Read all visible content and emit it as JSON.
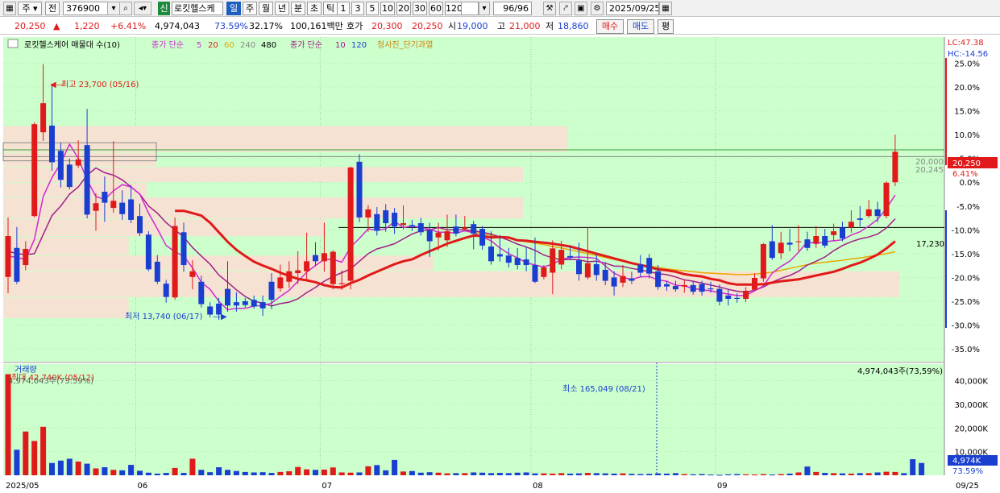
{
  "toolbar": {
    "period": "주",
    "prev_label": "전",
    "code": "376900",
    "market_badge": "신",
    "name": "로킷헬스케",
    "tabs": [
      "일",
      "주",
      "월",
      "년",
      "분",
      "초",
      "틱"
    ],
    "active_tab": "일",
    "intervals": [
      "1",
      "3",
      "5",
      "10",
      "20",
      "30",
      "60",
      "120"
    ],
    "count": "96/96",
    "date": "2025/09/25"
  },
  "quote": {
    "price": "20,250",
    "change": "1,220",
    "change_pct": "+6.41%",
    "volume": "4,974,043",
    "vol_ratio": "73.59%",
    "turnover": "32.17%",
    "amount": "100,161백만",
    "ask_label": "호가",
    "ask": "20,300",
    "bid": "20,250",
    "open_label": "시",
    "open": "19,000",
    "high_label": "고",
    "high": "21,000",
    "low_label": "저",
    "low": "18,860",
    "buy_label": "매수",
    "sell_label": "매도",
    "avg_label": "평"
  },
  "legend": {
    "item1": "로킷헬스케어 매물대 수(10)",
    "item2": "종가 단순",
    "ma_a": [
      "5",
      "20",
      "60",
      "240",
      "480"
    ],
    "item3": "종가 단순",
    "ma_b": [
      "10",
      "120"
    ],
    "item4": "청사진_단기과열"
  },
  "annotations": {
    "high": "최고 23,700 (05/16)",
    "low": "최저 13,740 (06/17)",
    "vol_title": "거래량",
    "vol_max": "최대 42,740K (05/12)",
    "vol_ref": "4,974,043주(73.59%)",
    "vol_min": "최소 165,049 (08/21)",
    "vol_top_right": "4,974,043주(73,59%)",
    "lc": "LC:47.38",
    "hc": "HC:-14.56",
    "price_tag": "20,250",
    "pct_tag": "6.41%",
    "line_20000": "20,000",
    "line_20245": "20,245",
    "hline_label": "17,230",
    "vol_tag": "4,974K",
    "vol_tag_pct": "73.59%"
  },
  "colors": {
    "up": "#e01a1a",
    "down": "#1a3fd0",
    "ma5": "#d02ad0",
    "ma20": "#e01a1a",
    "ma60": "#e8a800",
    "ma10": "#a0208a",
    "plot_bg": "#ccffcc",
    "supply": "#f6e2d2"
  },
  "chart_data": {
    "type": "candlestick",
    "y_ticks": [
      "25.0%",
      "20.0%",
      "15.0%",
      "10.0%",
      "5.0%",
      "0.0%",
      "-5.0%",
      "-10.0%",
      "-15.0%",
      "-20.0%",
      "-25.0%",
      "-30.0%",
      "-35.0%"
    ],
    "y_range_pct": [
      -37.7,
      30.5
    ],
    "vol_ticks": [
      "40,000K",
      "30,000K",
      "20,000K",
      "10,000K"
    ],
    "vol_range": [
      0,
      47000
    ],
    "x_labels": [
      "2025/05",
      "06",
      "07",
      "08",
      "09",
      "09/25"
    ],
    "hline_pct": -9.5,
    "candles": [
      {
        "o": -19.9,
        "c": -11.3,
        "h": -7.4,
        "l": -23.3
      },
      {
        "o": -13.8,
        "c": -20.9,
        "h": -9.4,
        "l": -21.4
      },
      {
        "o": -17.4,
        "c": -14.0,
        "h": -12.4,
        "l": -18.5
      },
      {
        "o": -7.1,
        "c": 12.2,
        "h": 12.6,
        "l": -7.4
      },
      {
        "o": 10.5,
        "c": 16.6,
        "h": 24.8,
        "l": 8.7
      },
      {
        "o": 11.9,
        "c": 4.2,
        "h": 20.4,
        "l": 2.4
      },
      {
        "o": 6.6,
        "c": 0.5,
        "h": 8.3,
        "l": -1.1
      },
      {
        "o": 3.7,
        "c": -1.0,
        "h": 5.0,
        "l": -1.5
      },
      {
        "o": 3.5,
        "c": 4.8,
        "h": 8.8,
        "l": 3.0
      },
      {
        "o": 7.8,
        "c": -6.8,
        "h": 15.4,
        "l": -7.6
      },
      {
        "o": -6.0,
        "c": -4.4,
        "h": -2.3,
        "l": -10.2
      },
      {
        "o": -2.0,
        "c": -4.3,
        "h": 1.2,
        "l": -8.3
      },
      {
        "o": -5.4,
        "c": -3.9,
        "h": 8.6,
        "l": -6.4
      },
      {
        "o": -4.3,
        "c": -6.7,
        "h": -1.7,
        "l": -7.9
      },
      {
        "o": -3.6,
        "c": -7.9,
        "h": -0.6,
        "l": -8.6
      },
      {
        "o": -7.1,
        "c": -10.7,
        "h": -4.5,
        "l": -11.3
      },
      {
        "o": -11.0,
        "c": -18.3,
        "h": -10.3,
        "l": -18.7
      },
      {
        "o": -16.7,
        "c": -20.9,
        "h": -15.3,
        "l": -21.4
      },
      {
        "o": -21.3,
        "c": -24.1,
        "h": -20.5,
        "l": -25.3
      },
      {
        "o": -24.2,
        "c": -9.2,
        "h": -7.4,
        "l": -24.7
      },
      {
        "o": -10.5,
        "c": -17.4,
        "h": -8.5,
        "l": -18.8
      },
      {
        "o": -19.9,
        "c": -18.7,
        "h": -16.4,
        "l": -22.5
      },
      {
        "o": -20.9,
        "c": -25.6,
        "h": -19.6,
        "l": -26.3
      },
      {
        "o": -26.1,
        "c": -27.8,
        "h": -25.2,
        "l": -28.4
      },
      {
        "o": -25.5,
        "c": -27.8,
        "h": -24.3,
        "l": -28.9
      },
      {
        "o": -22.4,
        "c": -25.9,
        "h": -16.6,
        "l": -27.2
      },
      {
        "o": -25.2,
        "c": -25.9,
        "h": -23.1,
        "l": -27.2
      },
      {
        "o": -25.0,
        "c": -25.8,
        "h": -24.3,
        "l": -26.3
      },
      {
        "o": -24.7,
        "c": -26.1,
        "h": -23.8,
        "l": -26.6
      },
      {
        "o": -25.2,
        "c": -26.5,
        "h": -23.8,
        "l": -28.1
      },
      {
        "o": -20.9,
        "c": -24.7,
        "h": -19.1,
        "l": -26.7
      },
      {
        "o": -22.3,
        "c": -20.0,
        "h": -17.3,
        "l": -23.0
      },
      {
        "o": -20.9,
        "c": -18.7,
        "h": -16.6,
        "l": -22.2
      },
      {
        "o": -19.1,
        "c": -18.5,
        "h": -14.5,
        "l": -21.4
      },
      {
        "o": -18.7,
        "c": -16.6,
        "h": -10.6,
        "l": -20.7
      },
      {
        "o": -15.3,
        "c": -16.6,
        "h": -12.6,
        "l": -17.6
      },
      {
        "o": -16.6,
        "c": -14.9,
        "h": -8.5,
        "l": -18.8
      },
      {
        "o": -21.4,
        "c": -14.6,
        "h": -14.3,
        "l": -22.5
      },
      {
        "o": -21.4,
        "c": -21.2,
        "h": -18.5,
        "l": -22.6
      },
      {
        "o": -20.7,
        "c": 3.1,
        "h": 3.3,
        "l": -22.5
      },
      {
        "o": 4.3,
        "c": -7.4,
        "h": 5.9,
        "l": -8.4
      },
      {
        "o": -7.4,
        "c": -5.7,
        "h": -4.8,
        "l": -10.4
      },
      {
        "o": -6.7,
        "c": -10.2,
        "h": -5.2,
        "l": -11.2
      },
      {
        "o": -5.9,
        "c": -8.6,
        "h": -4.6,
        "l": -10.4
      },
      {
        "o": -6.4,
        "c": -9.3,
        "h": -5.4,
        "l": -10.9
      },
      {
        "o": -9.0,
        "c": -8.6,
        "h": -4.9,
        "l": -9.9
      },
      {
        "o": -9.0,
        "c": -9.3,
        "h": -7.9,
        "l": -10.2
      },
      {
        "o": -8.6,
        "c": -10.5,
        "h": -7.5,
        "l": -11.2
      },
      {
        "o": -10.1,
        "c": -12.4,
        "h": -8.5,
        "l": -15.7
      },
      {
        "o": -11.6,
        "c": -10.6,
        "h": -8.5,
        "l": -14.3
      },
      {
        "o": -12.2,
        "c": -10.3,
        "h": -6.8,
        "l": -13.6
      },
      {
        "o": -9.3,
        "c": -10.8,
        "h": -6.8,
        "l": -11.4
      },
      {
        "o": -9.8,
        "c": -9.5,
        "h": -7.1,
        "l": -10.2
      },
      {
        "o": -8.8,
        "c": -10.8,
        "h": -8.1,
        "l": -14.1
      },
      {
        "o": -9.8,
        "c": -13.3,
        "h": -9.2,
        "l": -14.2
      },
      {
        "o": -13.5,
        "c": -16.6,
        "h": -10.3,
        "l": -17.3
      },
      {
        "o": -15.1,
        "c": -15.6,
        "h": -11.1,
        "l": -16.7
      },
      {
        "o": -15.4,
        "c": -16.9,
        "h": -13.8,
        "l": -17.9
      },
      {
        "o": -15.9,
        "c": -17.4,
        "h": -13.8,
        "l": -18.3
      },
      {
        "o": -16.2,
        "c": -17.4,
        "h": -13.6,
        "l": -18.7
      },
      {
        "o": -17.4,
        "c": -20.9,
        "h": -11.6,
        "l": -21.2
      },
      {
        "o": -19.9,
        "c": -17.9,
        "h": -17.4,
        "l": -20.4
      },
      {
        "o": -19.0,
        "c": -13.9,
        "h": -12.2,
        "l": -23.5
      },
      {
        "o": -17.3,
        "c": -14.2,
        "h": -12.3,
        "l": -18.3
      },
      {
        "o": -15.5,
        "c": -15.8,
        "h": -13.5,
        "l": -16.3
      },
      {
        "o": -16.4,
        "c": -19.3,
        "h": -12.7,
        "l": -20.7
      },
      {
        "o": -20.0,
        "c": -17.0,
        "h": -9.4,
        "l": -20.4
      },
      {
        "o": -17.2,
        "c": -19.5,
        "h": -15.1,
        "l": -20.7
      },
      {
        "o": -18.4,
        "c": -20.7,
        "h": -16.8,
        "l": -21.6
      },
      {
        "o": -20.0,
        "c": -21.9,
        "h": -18.7,
        "l": -23.8
      },
      {
        "o": -21.1,
        "c": -19.7,
        "h": -17.4,
        "l": -22.0
      },
      {
        "o": -20.2,
        "c": -20.7,
        "h": -18.8,
        "l": -21.4
      },
      {
        "o": -17.3,
        "c": -19.0,
        "h": -15.3,
        "l": -19.9
      },
      {
        "o": -15.9,
        "c": -19.2,
        "h": -15.1,
        "l": -20.2
      },
      {
        "o": -18.7,
        "c": -22.0,
        "h": -17.4,
        "l": -22.6
      },
      {
        "o": -21.4,
        "c": -21.9,
        "h": -20.8,
        "l": -22.8
      },
      {
        "o": -21.8,
        "c": -22.5,
        "h": -20.7,
        "l": -23.0
      },
      {
        "o": -21.9,
        "c": -21.6,
        "h": -20.6,
        "l": -23.2
      },
      {
        "o": -21.6,
        "c": -23.0,
        "h": -20.8,
        "l": -23.6
      },
      {
        "o": -21.4,
        "c": -23.0,
        "h": -20.7,
        "l": -23.8
      },
      {
        "o": -22.3,
        "c": -22.5,
        "h": -20.9,
        "l": -23.2
      },
      {
        "o": -22.4,
        "c": -25.1,
        "h": -21.5,
        "l": -25.9
      },
      {
        "o": -23.8,
        "c": -24.5,
        "h": -22.6,
        "l": -25.9
      },
      {
        "o": -24.3,
        "c": -24.5,
        "h": -23.3,
        "l": -25.3
      },
      {
        "o": -24.5,
        "c": -22.8,
        "h": -22.0,
        "l": -25.2
      },
      {
        "o": -22.6,
        "c": -20.1,
        "h": -19.1,
        "l": -22.6
      },
      {
        "o": -20.2,
        "c": -13.0,
        "h": -12.8,
        "l": -20.9
      },
      {
        "o": -12.4,
        "c": -15.9,
        "h": -9.0,
        "l": -16.3
      },
      {
        "o": -14.9,
        "c": -12.7,
        "h": -10.4,
        "l": -16.1
      },
      {
        "o": -12.7,
        "c": -13.1,
        "h": -9.8,
        "l": -14.5
      },
      {
        "o": -12.4,
        "c": -12.4,
        "h": -9.0,
        "l": -14.5
      },
      {
        "o": -12.0,
        "c": -13.8,
        "h": -10.4,
        "l": -14.4
      },
      {
        "o": -12.8,
        "c": -11.3,
        "h": -9.2,
        "l": -13.8
      },
      {
        "o": -11.3,
        "c": -13.3,
        "h": -9.8,
        "l": -13.8
      },
      {
        "o": -11.1,
        "c": -10.3,
        "h": -8.7,
        "l": -12.4
      },
      {
        "o": -9.5,
        "c": -11.8,
        "h": -8.3,
        "l": -12.4
      },
      {
        "o": -9.5,
        "c": -8.3,
        "h": -5.9,
        "l": -10.6
      },
      {
        "o": -7.6,
        "c": -7.9,
        "h": -5.0,
        "l": -9.3
      },
      {
        "o": -7.1,
        "c": -5.7,
        "h": -3.7,
        "l": -7.5
      },
      {
        "o": -5.7,
        "c": -7.1,
        "h": -4.1,
        "l": -8.4
      },
      {
        "o": -7.1,
        "c": -0.1,
        "h": 0.2,
        "l": -7.6
      },
      {
        "o": 0.0,
        "c": 6.4,
        "h": 10.0,
        "l": -0.8
      }
    ],
    "ma5": [
      -15.5,
      -15.8,
      -16.2,
      -12,
      -3,
      1,
      4,
      8,
      5,
      0.5,
      -3,
      -3.6,
      -1.8,
      -0.5,
      -1,
      -2.5,
      -6.5,
      -9.8,
      -13.3,
      -14.6,
      -15.5,
      -18,
      -21,
      -22.5,
      -25,
      -26.8,
      -26.5,
      -26.5,
      -26,
      -25.9,
      -25.4,
      -24,
      -22.7,
      -20.8,
      -18.9,
      -17.5,
      -16.2,
      -16.2,
      -16.8,
      -13.6,
      -11.8,
      -9.8,
      -10.1,
      -9.8,
      -8.2,
      -9.5,
      -9.2,
      -9.5,
      -9.9,
      -10.5,
      -10.5,
      -10.7,
      -10.2,
      -10.6,
      -11.5,
      -12.3,
      -13.8,
      -15,
      -15.9,
      -16.9,
      -17.4,
      -17.8,
      -17.2,
      -16.2,
      -15.8,
      -15.7,
      -15.8,
      -16,
      -17.6,
      -19.1,
      -20,
      -20.4,
      -19.9,
      -19.8,
      -20.5,
      -20.8,
      -21.6,
      -21.8,
      -22.3,
      -22.6,
      -22.8,
      -23.2,
      -23.5,
      -23.8,
      -23.8,
      -22.8,
      -21.8,
      -19.1,
      -17.7,
      -16.6,
      -14.7,
      -12.5,
      -12.9,
      -12.5,
      -12.3,
      -12.1,
      -11.1,
      -10.4,
      -9.2,
      -7.8,
      -5.5,
      -2.7
    ],
    "ma10": [
      -14.5,
      -15,
      -15.2,
      -15,
      -11,
      -7,
      -5,
      -2.5,
      -1,
      1.5,
      3,
      2,
      1.5,
      0.5,
      -1,
      -2.5,
      -5,
      -6.5,
      -8.5,
      -10,
      -11.5,
      -13.7,
      -15.5,
      -17.2,
      -19.5,
      -21,
      -22.6,
      -24,
      -25,
      -25.4,
      -26,
      -25.5,
      -25.2,
      -24.5,
      -23.2,
      -22.1,
      -20.8,
      -19.8,
      -19,
      -18.2,
      -16.6,
      -15,
      -14,
      -13.5,
      -12.9,
      -11.9,
      -10.9,
      -10.2,
      -10,
      -9.5,
      -10,
      -10,
      -10,
      -10.2,
      -10.5,
      -10.9,
      -11.5,
      -12.2,
      -13,
      -13.6,
      -14.3,
      -15.3,
      -15.9,
      -16.3,
      -16.2,
      -16.3,
      -16.7,
      -16.6,
      -17,
      -17.6,
      -17.7,
      -18.1,
      -18.4,
      -18.8,
      -19.2,
      -19.4,
      -19.9,
      -20.5,
      -20.8,
      -21.2,
      -21.6,
      -22,
      -22.5,
      -22.9,
      -23.1,
      -22.7,
      -22,
      -21,
      -20.2,
      -19.6,
      -18.7,
      -17.4,
      -16.6,
      -15.7,
      -14.4,
      -13.3,
      -12.5,
      -11.9,
      -11.5,
      -10.9,
      -9.6,
      -7.7
    ],
    "ma20": [
      null,
      null,
      null,
      null,
      null,
      null,
      null,
      null,
      null,
      null,
      null,
      null,
      null,
      null,
      null,
      null,
      null,
      null,
      null,
      -6,
      -6,
      -6.5,
      -7,
      -8.5,
      -10.5,
      -12.5,
      -14.2,
      -15.5,
      -16.7,
      -17.5,
      -18.2,
      -19,
      -19.7,
      -20.3,
      -20.6,
      -21,
      -21.6,
      -22,
      -22.1,
      -21.2,
      -20.5,
      -19.6,
      -18.8,
      -18,
      -17.2,
      -16.6,
      -16.2,
      -15.3,
      -14.5,
      -13.7,
      -12.9,
      -12.3,
      -11.7,
      -11.2,
      -11.3,
      -11.6,
      -11.5,
      -11.6,
      -12.2,
      -12.3,
      -12.5,
      -12.7,
      -12.9,
      -13.2,
      -13.5,
      -14,
      -14.5,
      -15,
      -15.5,
      -16,
      -16.5,
      -17,
      -17.4,
      -17.8,
      -18.3,
      -18.5,
      -18.8,
      -19.3,
      -19.6,
      -19.8,
      -20.3,
      -20.6,
      -21.2,
      -21.5,
      -21.5,
      -21.5,
      -21.4,
      -21.1,
      -20.8,
      -20.6,
      -20.4,
      -20,
      -19.6,
      -19.2,
      -18.8,
      -18.2,
      -17.5,
      -16.9,
      -16.1,
      -15.2,
      -13.9,
      -12.4
    ],
    "ma60": [
      null,
      null,
      null,
      null,
      null,
      null,
      null,
      null,
      null,
      null,
      null,
      null,
      null,
      null,
      null,
      null,
      null,
      null,
      null,
      null,
      null,
      null,
      null,
      null,
      null,
      null,
      null,
      null,
      null,
      null,
      null,
      null,
      null,
      null,
      null,
      null,
      null,
      null,
      null,
      null,
      null,
      null,
      null,
      null,
      null,
      null,
      null,
      null,
      null,
      null,
      null,
      null,
      -10,
      -10.5,
      -10.8,
      -11.2,
      -11.5,
      -11.8,
      -12.2,
      -12.5,
      -12.8,
      -13.1,
      -13.5,
      -13.8,
      -14.2,
      -14.6,
      -15,
      -15.4,
      -15.8,
      -16.2,
      -16.6,
      -17,
      -17.3,
      -17.6,
      -17.9,
      -18.2,
      -18.4,
      -18.6,
      -18.8,
      -19,
      -19.1,
      -19.2,
      -19.3,
      -19.4,
      -19.4,
      -19.3,
      -19.1,
      -18.9,
      -18.5,
      -18.1,
      -17.7,
      -17.3,
      -17,
      -16.8,
      -16.6,
      -16.4,
      -16.1,
      -15.9,
      -15.6,
      -15.3,
      -15,
      -14.6
    ],
    "volume": [
      42740,
      10800,
      18500,
      14500,
      20500,
      5200,
      6200,
      7000,
      5800,
      4900,
      2900,
      3400,
      2300,
      2100,
      4400,
      1900,
      1100,
      700,
      1000,
      3100,
      1000,
      7000,
      2300,
      1300,
      3400,
      2300,
      1800,
      1400,
      1200,
      1300,
      1000,
      1400,
      1700,
      3500,
      2500,
      2300,
      2400,
      3300,
      1200,
      1100,
      1200,
      3800,
      4300,
      2100,
      6500,
      1600,
      1800,
      1100,
      1300,
      1100,
      800,
      900,
      900,
      1200,
      1100,
      900,
      1000,
      900,
      1100,
      1200,
      800,
      800,
      700,
      900,
      700,
      800,
      1000,
      900,
      800,
      700,
      800,
      600,
      500,
      600,
      800,
      700,
      900,
      500,
      400,
      500,
      300,
      200,
      400,
      500,
      400,
      300,
      500,
      300,
      500,
      700,
      1200,
      3700,
      1400,
      1000,
      900,
      800,
      700,
      900,
      900,
      1200,
      1500,
      1400,
      900,
      6800,
      5200
    ],
    "supply_zones": [
      {
        "from": 6.2,
        "to": 11.8,
        "len": 0.63
      },
      {
        "from": 3.2,
        "to": 6.2,
        "len": 0.17
      },
      {
        "from": -0.1,
        "to": 3.2,
        "len": 0.58
      },
      {
        "from": -3.2,
        "to": -0.1,
        "len": 0.16
      },
      {
        "from": -7.8,
        "to": -3.2,
        "len": 0.58
      },
      {
        "from": -11.5,
        "to": -7.8,
        "len": 0.36
      },
      {
        "from": -15.4,
        "to": -11.5,
        "len": 0.14
      },
      {
        "from": -18.7,
        "to": -15.4,
        "len": 0.48
      },
      {
        "from": -24.3,
        "to": -18.7,
        "len": 1.0
      },
      {
        "from": -28.7,
        "to": -24.3,
        "len": 0.14
      }
    ]
  }
}
